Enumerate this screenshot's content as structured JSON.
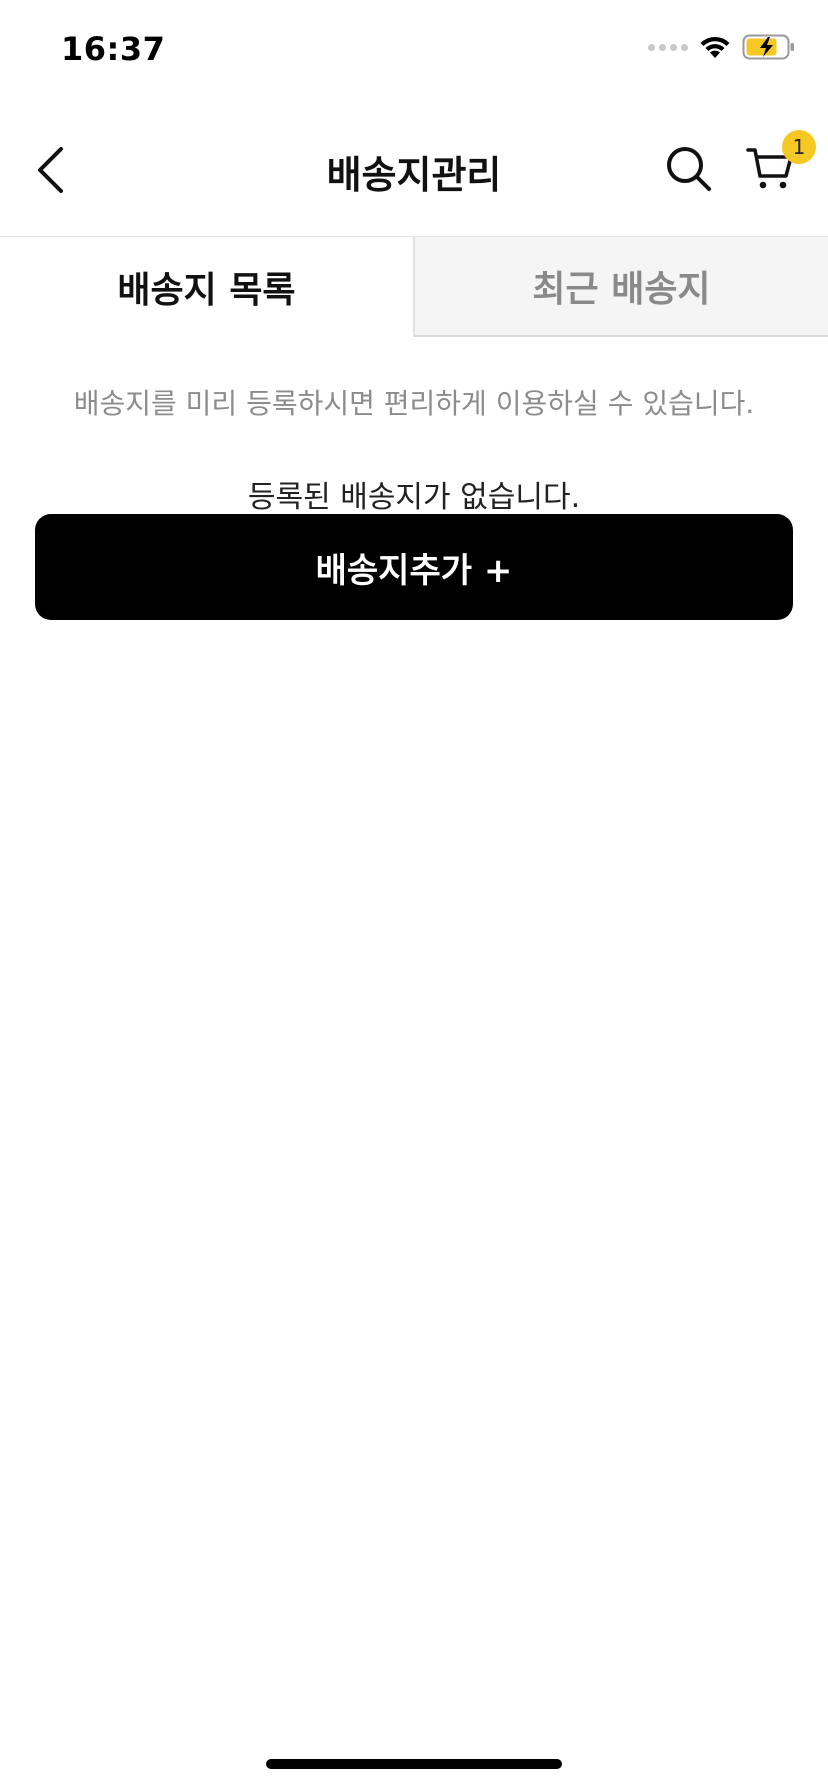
{
  "status_bar": {
    "time": "16:37"
  },
  "header": {
    "title": "배송지관리",
    "back_icon": "chevron-left-icon",
    "search_icon": "search-icon",
    "cart_icon": "cart-icon",
    "cart_badge": "1"
  },
  "tabs": [
    {
      "label": "배송지 목록",
      "active": true
    },
    {
      "label": "최근 배송지",
      "active": false
    }
  ],
  "content": {
    "info_text": "배송지를 미리 등록하시면 편리하게 이용하실 수 있습니다.",
    "empty_text": "등록된 배송지가 없습니다.",
    "add_button_label": "배송지추가 +"
  },
  "colors": {
    "badge": "#f6c823",
    "primary_button": "#000000",
    "inactive_tab_bg": "#f5f5f5",
    "muted_text": "#8c8c8c"
  }
}
